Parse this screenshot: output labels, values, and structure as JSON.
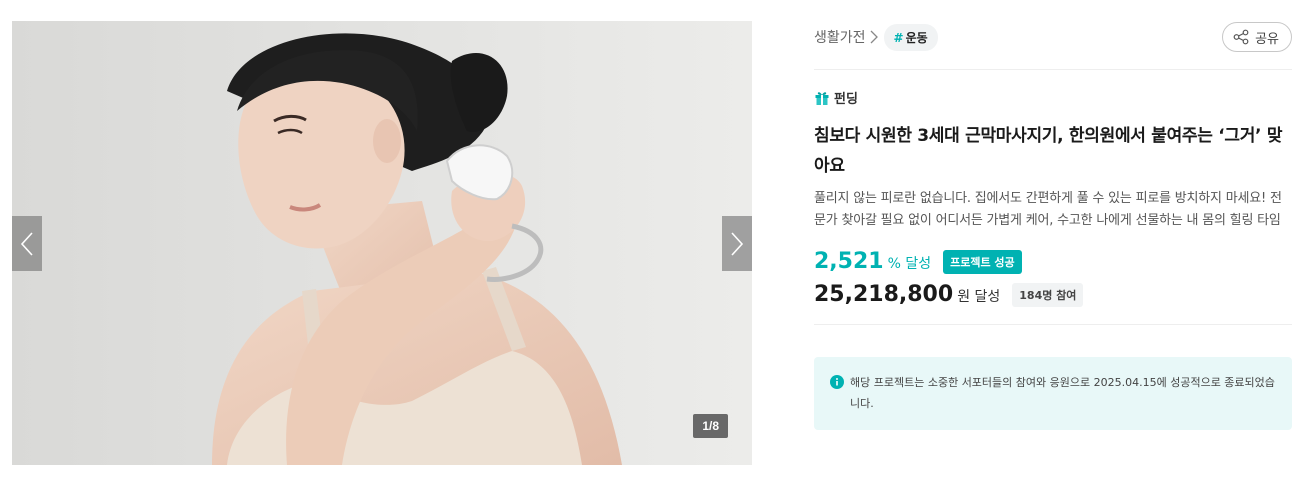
{
  "gallery": {
    "counter": "1/8",
    "prev_icon": "chevron-left-icon",
    "next_icon": "chevron-right-icon"
  },
  "breadcrumb": {
    "category": "생활가전",
    "tag_hash": "#",
    "tag": "운동"
  },
  "share": {
    "label": "공유",
    "icon": "share-icon"
  },
  "project": {
    "kind_icon": "gift-icon",
    "kind": "펀딩",
    "title": "침보다 시원한 3세대 근막마사지기, 한의원에서 붙여주는 ‘그거’ 맞아요",
    "description": "풀리지 않는 피로란 없습니다. 집에서도 간편하게 풀 수 있는 피로를 방치하지 마세요! 전문가 찾아갈 필요 없이 어디서든 가볍게 케어, 수고한 나에게 선물하는 내 몸의 힐링 타임"
  },
  "stats": {
    "rate": "2,521",
    "rate_unit": "% 달성",
    "status_badge": "프로젝트 성공",
    "amount": "25,218,800",
    "amount_unit": "원 달성",
    "participants": "184명 참여"
  },
  "notice": {
    "icon": "info-icon",
    "text": "해당 프로젝트는 소중한 서포터들의 참여와 응원으로 2025.04.15에 성공적으로 종료되었습니다."
  },
  "colors": {
    "accent": "#00b2b2",
    "notice_bg": "#e8f8f8"
  }
}
